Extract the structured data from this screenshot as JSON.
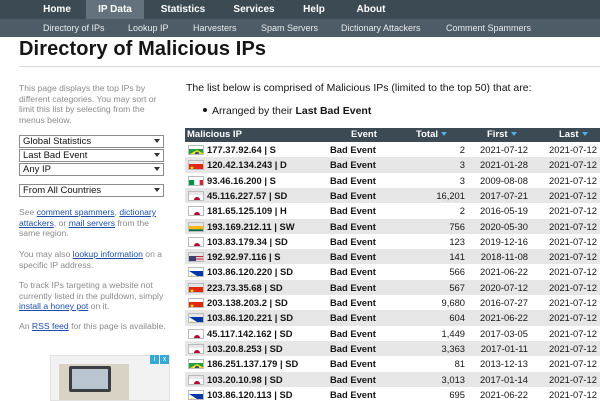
{
  "nav": {
    "tabs": [
      {
        "label": "Home",
        "active": false
      },
      {
        "label": "IP Data",
        "active": true
      },
      {
        "label": "Statistics",
        "active": false
      },
      {
        "label": "Services",
        "active": false
      },
      {
        "label": "Help",
        "active": false
      },
      {
        "label": "About",
        "active": false
      }
    ],
    "subnav": [
      "Directory of IPs",
      "Lookup IP",
      "Harvesters",
      "Spam Servers",
      "Dictionary Attackers",
      "Comment Spammers"
    ]
  },
  "page": {
    "title": "Directory of Malicious IPs"
  },
  "sidebar": {
    "intro": "This page displays the top IPs by different categories. You may sort or limit this list by selecting from the menus below.",
    "selects": {
      "category": "Global Statistics",
      "sort": "Last Bad Event",
      "ip_version": "Any IP",
      "country": "From All Countries"
    },
    "see": {
      "prefix": "See",
      "link1": "comment spammers",
      "sep": ",",
      "link2": "dictionary attackers",
      "mid": ", or",
      "link3": "mail servers",
      "suffix": "from the same region."
    },
    "lookup": {
      "prefix": "You may also",
      "link": "lookup information",
      "suffix": "on a specific IP address."
    },
    "honeypot": {
      "prefix": "To track IPs targeting a website not currently listed in the pulldown, simply",
      "link": "install a honey pot",
      "suffix": "on it."
    },
    "rss": {
      "prefix": "An",
      "link": "RSS feed",
      "suffix": "for this page is available."
    },
    "ad_icons": [
      "i",
      "x"
    ]
  },
  "main": {
    "intro": "The list below is comprised of Malicious IPs (limited to the top 50) that are:",
    "bullet_prefix": "Arranged by their",
    "bullet_strong": "Last Bad Event"
  },
  "table": {
    "headers": {
      "ip": "Malicious IP",
      "event": "Event",
      "total": "Total",
      "first": "First",
      "last": "Last"
    },
    "rows": [
      {
        "flag": "br",
        "ip": "177.37.92.64 | S",
        "event": "Bad Event",
        "total": "2",
        "first": "2021-07-12",
        "last": "2021-07-12"
      },
      {
        "flag": "cn",
        "ip": "120.42.134.243 | D",
        "event": "Bad Event",
        "total": "3",
        "first": "2021-01-28",
        "last": "2021-07-12"
      },
      {
        "flag": "it",
        "ip": "93.46.16.200 | S",
        "event": "Bad Event",
        "total": "3",
        "first": "2009-08-08",
        "last": "2021-07-12"
      },
      {
        "flag": "jp",
        "ip": "45.116.227.57 | SD",
        "event": "Bad Event",
        "total": "16,201",
        "first": "2017-07-21",
        "last": "2021-07-12"
      },
      {
        "flag": "jp",
        "ip": "181.65.125.109 | H",
        "event": "Bad Event",
        "total": "2",
        "first": "2016-05-19",
        "last": "2021-07-12"
      },
      {
        "flag": "lt",
        "ip": "193.169.212.11 | SW",
        "event": "Bad Event",
        "total": "756",
        "first": "2020-05-30",
        "last": "2021-07-12"
      },
      {
        "flag": "jp",
        "ip": "103.83.179.34 | SD",
        "event": "Bad Event",
        "total": "123",
        "first": "2019-12-16",
        "last": "2021-07-12"
      },
      {
        "flag": "us",
        "ip": "192.92.97.116 | S",
        "event": "Bad Event",
        "total": "141",
        "first": "2018-11-08",
        "last": "2021-07-12"
      },
      {
        "flag": "ph",
        "ip": "103.86.120.220 | SD",
        "event": "Bad Event",
        "total": "566",
        "first": "2021-06-22",
        "last": "2021-07-12"
      },
      {
        "flag": "cn",
        "ip": "223.73.35.68 | SD",
        "event": "Bad Event",
        "total": "567",
        "first": "2020-07-12",
        "last": "2021-07-12"
      },
      {
        "flag": "cn",
        "ip": "203.138.203.2 | SD",
        "event": "Bad Event",
        "total": "9,680",
        "first": "2016-07-27",
        "last": "2021-07-12"
      },
      {
        "flag": "ph",
        "ip": "103.86.120.221 | SD",
        "event": "Bad Event",
        "total": "604",
        "first": "2021-06-22",
        "last": "2021-07-12"
      },
      {
        "flag": "jp",
        "ip": "45.117.142.162 | SD",
        "event": "Bad Event",
        "total": "1,449",
        "first": "2017-03-05",
        "last": "2021-07-12"
      },
      {
        "flag": "jp",
        "ip": "103.20.8.253 | SD",
        "event": "Bad Event",
        "total": "3,363",
        "first": "2017-01-11",
        "last": "2021-07-12"
      },
      {
        "flag": "br",
        "ip": "186.251.137.179 | SD",
        "event": "Bad Event",
        "total": "81",
        "first": "2013-12-13",
        "last": "2021-07-12"
      },
      {
        "flag": "jp",
        "ip": "103.20.10.98 | SD",
        "event": "Bad Event",
        "total": "3,013",
        "first": "2017-01-14",
        "last": "2021-07-12"
      },
      {
        "flag": "ph",
        "ip": "103.86.120.113 | SD",
        "event": "Bad Event",
        "total": "695",
        "first": "2021-06-22",
        "last": "2021-07-12"
      }
    ]
  },
  "colors": {
    "nav_bg": "#3c4a54",
    "nav_active": "#63727d",
    "subnav_bg": "#4d5c66",
    "link": "#1f4fa5",
    "sort_arrow": "#4fb2e6",
    "row_alt": "#e6e6e6"
  }
}
